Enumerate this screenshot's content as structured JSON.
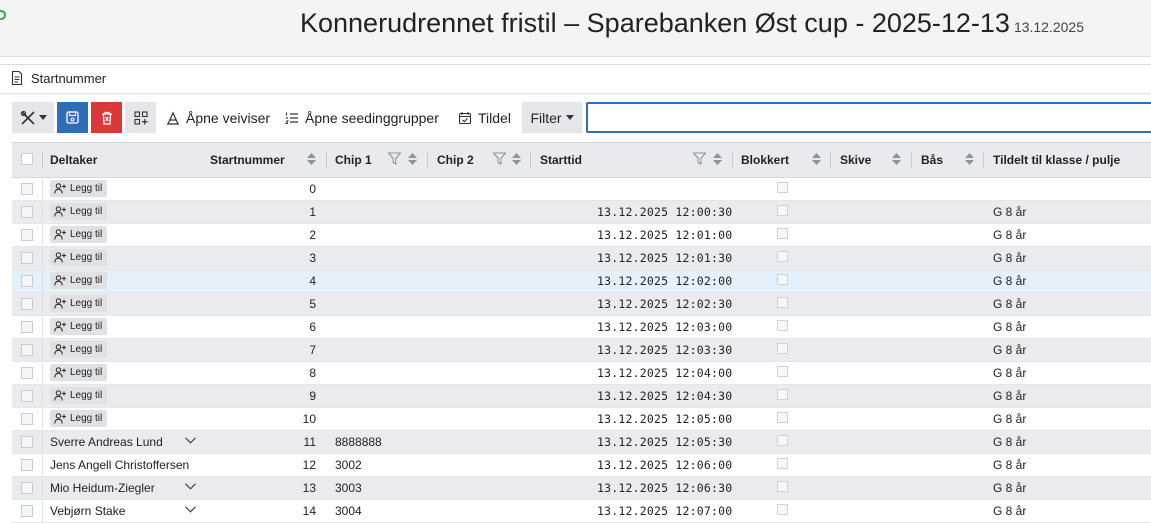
{
  "app": {
    "title": "Konnerudrennet fristil – Sparebanken Øst cup - 2025-12-13",
    "title_date": "13.12.2025",
    "panel_title": "Startnummer",
    "accent_color": "#2f6db5",
    "danger_color": "#d9393b"
  },
  "toolbar": {
    "tools_icon": "tools-icon",
    "save_icon": "save-icon",
    "delete_icon": "delete-icon",
    "grid_icon": "grid-add-icon",
    "open_wizard_label": "Åpne veiviser",
    "open_seeding_label": "Åpne seedinggrupper",
    "assign_label": "Tildel",
    "filter_label": "Filter",
    "search_value": ""
  },
  "columns": {
    "participant": "Deltaker",
    "bib": "Startnummer",
    "chip1": "Chip 1",
    "chip2": "Chip 2",
    "start_time": "Starttid",
    "blocked": "Blokkert",
    "lane": "Skive",
    "pen": "Bås",
    "assigned_class": "Tildelt til klasse / pulje"
  },
  "add_label": "Legg til",
  "rows": [
    {
      "participant": "",
      "bib": "0",
      "chip1": "",
      "start": "",
      "klasse": ""
    },
    {
      "participant": "",
      "bib": "1",
      "chip1": "",
      "start": "13.12.2025 12:00:30",
      "klasse": "G 8 år"
    },
    {
      "participant": "",
      "bib": "2",
      "chip1": "",
      "start": "13.12.2025 12:01:00",
      "klasse": "G 8 år"
    },
    {
      "participant": "",
      "bib": "3",
      "chip1": "",
      "start": "13.12.2025 12:01:30",
      "klasse": "G 8 år"
    },
    {
      "participant": "",
      "bib": "4",
      "chip1": "",
      "start": "13.12.2025 12:02:00",
      "klasse": "G 8 år"
    },
    {
      "participant": "",
      "bib": "5",
      "chip1": "",
      "start": "13.12.2025 12:02:30",
      "klasse": "G 8 år"
    },
    {
      "participant": "",
      "bib": "6",
      "chip1": "",
      "start": "13.12.2025 12:03:00",
      "klasse": "G 8 år"
    },
    {
      "participant": "",
      "bib": "7",
      "chip1": "",
      "start": "13.12.2025 12:03:30",
      "klasse": "G 8 år"
    },
    {
      "participant": "",
      "bib": "8",
      "chip1": "",
      "start": "13.12.2025 12:04:00",
      "klasse": "G 8 år"
    },
    {
      "participant": "",
      "bib": "9",
      "chip1": "",
      "start": "13.12.2025 12:04:30",
      "klasse": "G 8 år"
    },
    {
      "participant": "",
      "bib": "10",
      "chip1": "",
      "start": "13.12.2025 12:05:00",
      "klasse": "G 8 år"
    },
    {
      "participant": "Sverre Andreas Lund",
      "bib": "11",
      "chip1": "8888888",
      "start": "13.12.2025 12:05:30",
      "klasse": "G 8 år"
    },
    {
      "participant": "Jens Angell Christoffersen",
      "bib": "12",
      "chip1": "3002",
      "start": "13.12.2025 12:06:00",
      "klasse": "G 8 år"
    },
    {
      "participant": "Mio Heidum-Ziegler",
      "bib": "13",
      "chip1": "3003",
      "start": "13.12.2025 12:06:30",
      "klasse": "G 8 år"
    },
    {
      "participant": "Vebjørn Stake",
      "bib": "14",
      "chip1": "3004",
      "start": "13.12.2025 12:07:00",
      "klasse": "G 8 år"
    }
  ]
}
